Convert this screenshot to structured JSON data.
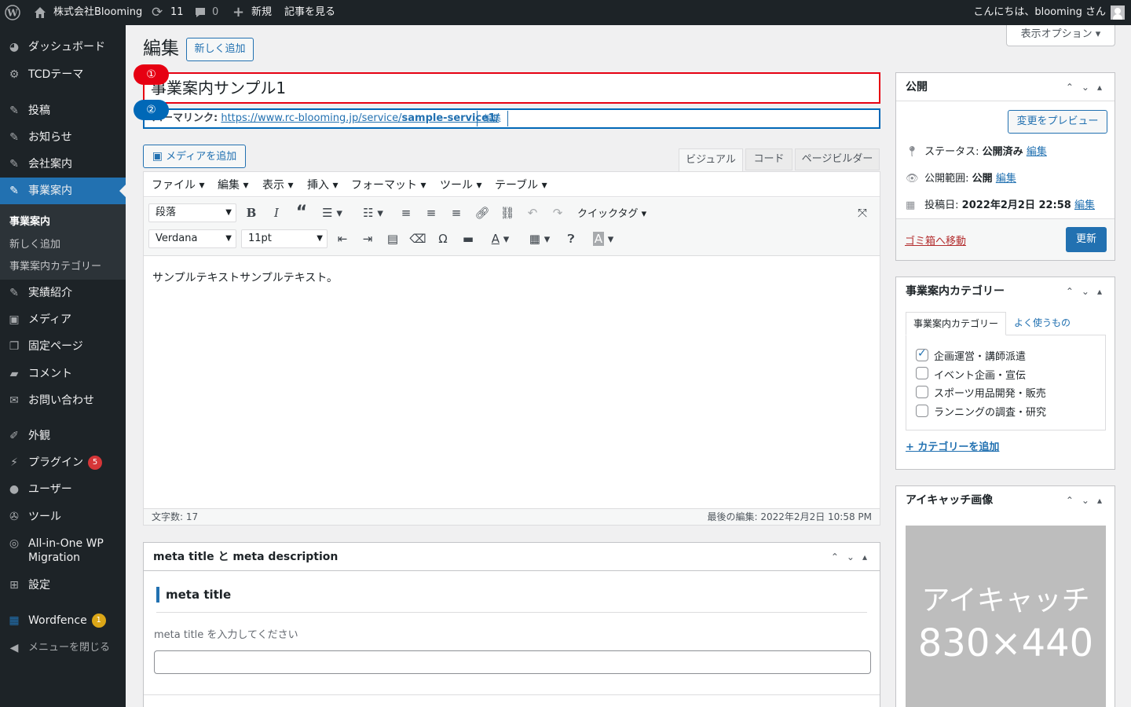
{
  "adminbar": {
    "site_name": "株式会社Blooming",
    "updates_count": "11",
    "comments_count": "0",
    "new_label": "新規",
    "view_post": "記事を見る",
    "greeting": "こんにちは、blooming さん"
  },
  "sidebar": {
    "items": [
      {
        "label": "ダッシュボード",
        "icon": "dashboard-icon"
      },
      {
        "label": "TCDテーマ",
        "icon": "gear-icon"
      },
      {
        "label": "投稿",
        "icon": "pin-icon"
      },
      {
        "label": "お知らせ",
        "icon": "pin-icon"
      },
      {
        "label": "会社案内",
        "icon": "pin-icon"
      },
      {
        "label": "事業案内",
        "icon": "pin-icon"
      },
      {
        "label": "実績紹介",
        "icon": "pin-icon"
      },
      {
        "label": "メディア",
        "icon": "media-icon"
      },
      {
        "label": "固定ページ",
        "icon": "page-icon"
      },
      {
        "label": "コメント",
        "icon": "comment-icon"
      },
      {
        "label": "お問い合わせ",
        "icon": "mail-icon"
      },
      {
        "label": "外観",
        "icon": "brush-icon"
      },
      {
        "label": "プラグイン",
        "icon": "plugin-icon",
        "badge": "5"
      },
      {
        "label": "ユーザー",
        "icon": "user-icon"
      },
      {
        "label": "ツール",
        "icon": "wrench-icon"
      },
      {
        "label": "All-in-One WP",
        "label2": "Migration",
        "icon": "migration-icon"
      },
      {
        "label": "設定",
        "icon": "settings-icon"
      },
      {
        "label": "Wordfence",
        "icon": "wordfence-icon",
        "badge": "1"
      },
      {
        "label": "メニューを閉じる",
        "icon": "collapse-icon"
      }
    ],
    "submenu": [
      "事業案内",
      "新しく追加",
      "事業案内カテゴリー"
    ]
  },
  "colors": {
    "accent": "#2271b1",
    "red_badge": "#d63638",
    "orange_badge": "#dba617",
    "annot_red": "#e60012",
    "annot_blue": "#0068b7"
  },
  "screen_options": "表示オプション",
  "page": {
    "title": "編集",
    "add_new": "新しく追加"
  },
  "post": {
    "title_value": "事業案内サンプル1",
    "permalink_label": "パーマリンク:",
    "permalink_url_base": "https://www.rc-blooming.jp/service/",
    "permalink_slug": "sample-service1",
    "permalink_end": "/",
    "permalink_edit": "編集"
  },
  "annotations": [
    "①",
    "②"
  ],
  "editor": {
    "add_media": "メディアを追加",
    "tabs": [
      "ビジュアル",
      "コード",
      "ページビルダー"
    ],
    "menus": [
      "ファイル",
      "編集",
      "表示",
      "挿入",
      "フォーマット",
      "ツール",
      "テーブル"
    ],
    "paragraph_select": "段落",
    "quicktag": "クイックタグ",
    "font_select": "Verdana",
    "size_select": "11pt",
    "content": "サンプルテキストサンプルテキスト。",
    "word_count": "文字数: 17",
    "last_edit": "最後の編集: 2022年2月2日 10:58 PM"
  },
  "meta_box": {
    "title": "meta title と meta description",
    "section_title": "meta title",
    "hint": "meta title を入力してください",
    "input_value": ""
  },
  "publish": {
    "title": "公開",
    "preview": "変更をプレビュー",
    "status_label": "ステータス:",
    "status_value": "公開済み",
    "visibility_label": "公開範囲:",
    "visibility_value": "公開",
    "date_label": "投稿日:",
    "date_value": "2022年2月2日 22:58",
    "edit": "編集",
    "trash": "ゴミ箱へ移動",
    "update": "更新"
  },
  "categories": {
    "title": "事業案内カテゴリー",
    "tabs": [
      "事業案内カテゴリー",
      "よく使うもの"
    ],
    "items": [
      {
        "label": "企画運営・講師派遣",
        "checked": true
      },
      {
        "label": "イベント企画・宣伝",
        "checked": false
      },
      {
        "label": "スポーツ用品開発・販売",
        "checked": false
      },
      {
        "label": "ランニングの調査・研究",
        "checked": false
      }
    ],
    "add_link": "+ カテゴリーを追加"
  },
  "featured": {
    "title": "アイキャッチ画像",
    "placeholder_line1": "アイキャッチ",
    "placeholder_line2": "830×440"
  }
}
